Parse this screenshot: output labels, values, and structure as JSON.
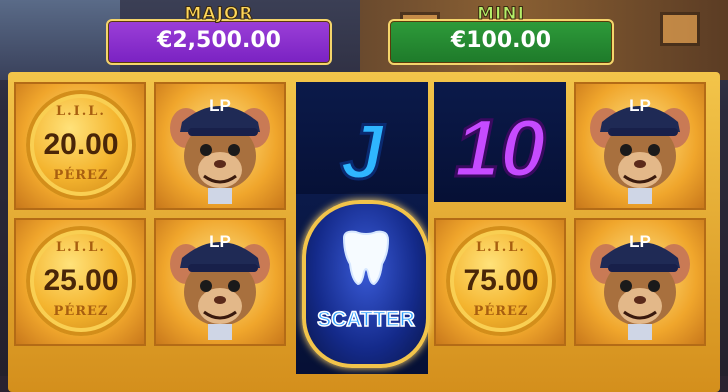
{
  "jackpots": {
    "major": {
      "title": "MAJOR",
      "amount": "€2,500.00"
    },
    "mini": {
      "title": "MINI",
      "amount": "€100.00"
    }
  },
  "reels": [
    {
      "symbols": [
        {
          "type": "coin",
          "top": "L.I.L.",
          "value": "20.00",
          "bottom": "PÉREZ"
        },
        {
          "type": "coin",
          "top": "L.I.L.",
          "value": "25.00",
          "bottom": "PÉREZ"
        }
      ]
    },
    {
      "symbols": [
        {
          "type": "rat",
          "cap": "LP"
        },
        {
          "type": "rat",
          "cap": "LP"
        }
      ]
    },
    {
      "symbols": [
        {
          "type": "letter",
          "label": "J"
        },
        {
          "type": "scatter",
          "label": "SCATTER"
        }
      ]
    },
    {
      "symbols": [
        {
          "type": "number",
          "label": "10"
        },
        {
          "type": "coin",
          "top": "L.I.L.",
          "value": "75.00",
          "bottom": "PÉREZ"
        }
      ]
    },
    {
      "symbols": [
        {
          "type": "rat",
          "cap": "LP"
        },
        {
          "type": "rat",
          "cap": "LP"
        }
      ]
    }
  ],
  "colors": {
    "major": "#7a22c2",
    "mini": "#1e7a2a",
    "frame": "#f3c54a",
    "coin": "#f4b42e"
  }
}
